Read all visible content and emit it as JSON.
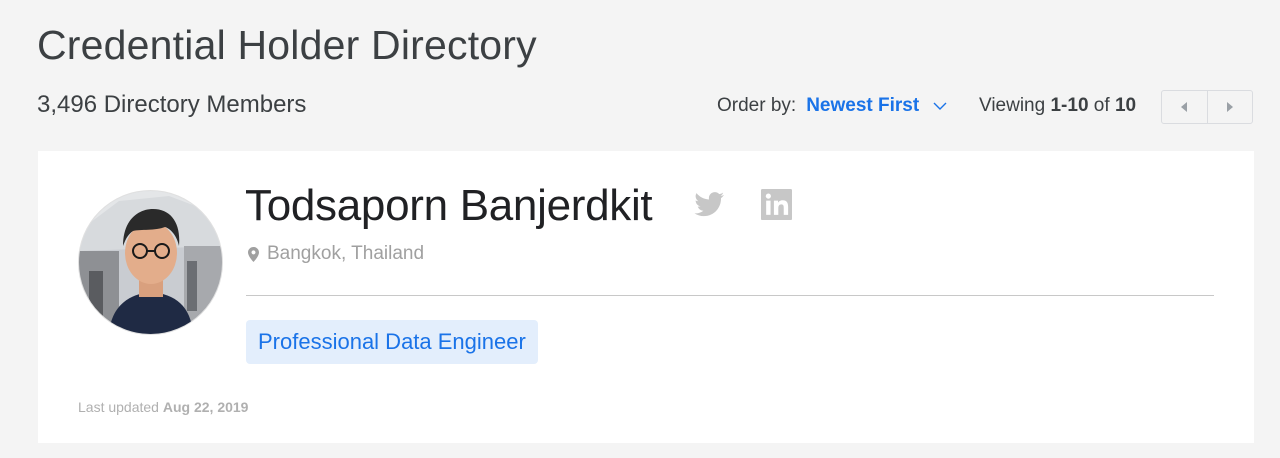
{
  "header": {
    "title": "Credential Holder Directory",
    "member_count": "3,496 Directory Members"
  },
  "controls": {
    "order_label": "Order by:",
    "order_value": "Newest First",
    "viewing_prefix": "Viewing",
    "viewing_range": "1-10",
    "viewing_of": "of",
    "viewing_total": "10"
  },
  "pager": {
    "prev_icon": "triangle-left-icon",
    "next_icon": "triangle-right-icon"
  },
  "member": {
    "name": "Todsaporn Banjerdkit",
    "location": "Bangkok, Thailand",
    "credential": "Professional Data Engineer",
    "last_updated_label": "Last updated",
    "last_updated_date": "Aug 22, 2019",
    "social": [
      "twitter-icon",
      "linkedin-icon"
    ]
  },
  "colors": {
    "accent": "#1a73e8",
    "badge_bg": "#e3eefc",
    "page_bg": "#f4f4f4"
  }
}
